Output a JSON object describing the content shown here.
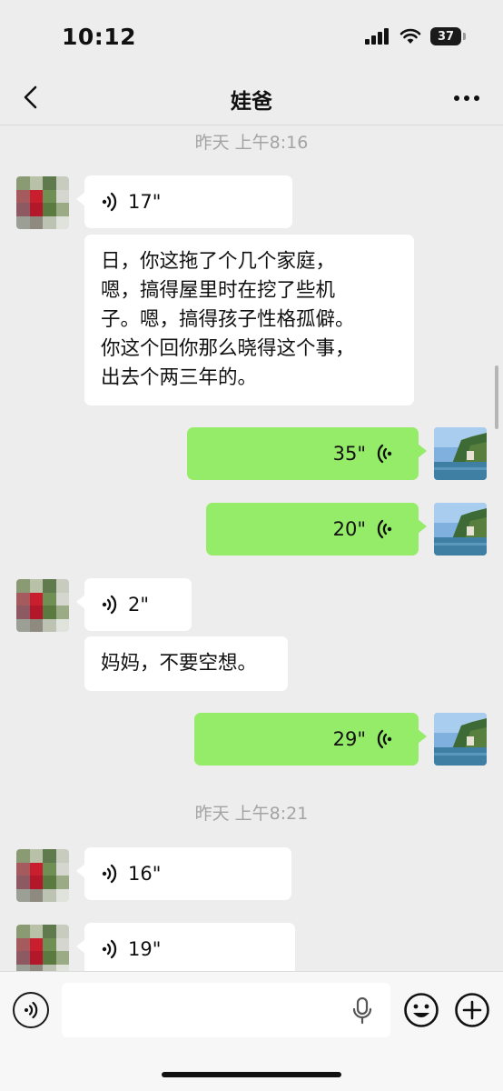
{
  "status_bar": {
    "time": "10:12",
    "battery_level": "37",
    "icons": [
      "signal-icon",
      "wifi-icon",
      "battery-icon"
    ]
  },
  "header": {
    "title": "娃爸",
    "back_icon": "chevron-left-icon",
    "more_icon": "more-dots-icon"
  },
  "messages": {
    "ts1": "昨天 上午8:16",
    "m1_duration": "17\"",
    "m2_text_lines": [
      "日，你这拖了个几个家庭，",
      "嗯，搞得屋里时在挖了些机",
      "子。嗯，搞得孩子性格孤僻。",
      "你这个回你那么晓得这个事，",
      "出去个两三年的。"
    ],
    "m3_duration": "35\"",
    "m4_duration": "20\"",
    "m5_duration": "2\"",
    "m6_text": "妈妈，不要空想。",
    "m7_duration": "29\"",
    "ts2": "昨天 上午8:21",
    "m8_duration": "16\"",
    "m9_duration": "19\""
  },
  "colors": {
    "background": "#ededed",
    "incoming_bubble": "#ffffff",
    "outgoing_bubble": "#95ec69",
    "timestamp": "#a3a3a3"
  },
  "input_bar": {
    "voice_toggle_icon": "voice-icon",
    "mic_icon": "mic-icon",
    "emoji_icon": "emoji-icon",
    "plus_icon": "plus-icon"
  }
}
